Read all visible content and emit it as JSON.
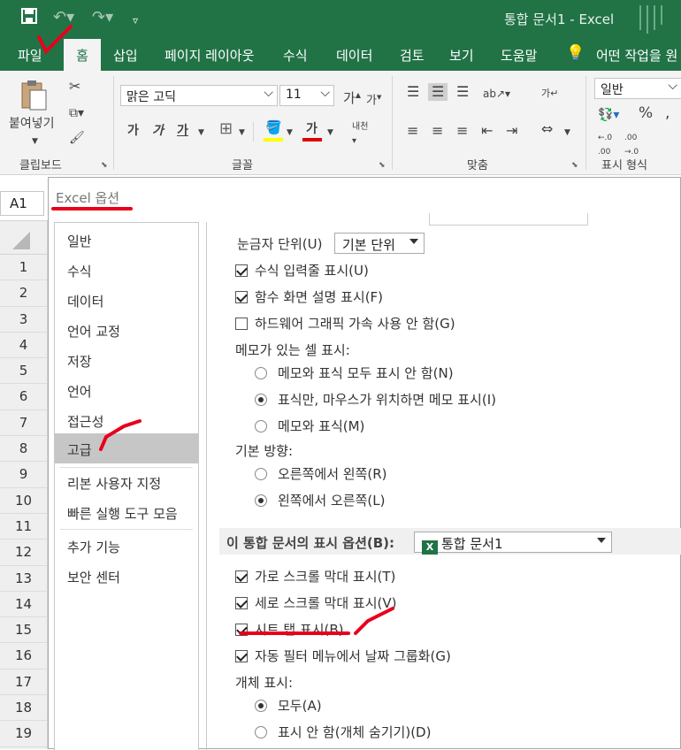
{
  "titlebar": {
    "doc_title": "통합 문서1 - Excel"
  },
  "ribbon_tabs": [
    "파일",
    "홈",
    "삽입",
    "페이지 레이아웃",
    "수식",
    "데이터",
    "검토",
    "보기",
    "도움말",
    "어떤 작업을 원"
  ],
  "ribbon": {
    "paste_label": "붙여넣기",
    "clipboard_label": "클립보드",
    "font_name": "맑은 고딕",
    "font_size": "11",
    "font_label": "글꼴",
    "align_label": "맞춤",
    "number_format": "일반",
    "number_label": "표시 형식",
    "bold": "가",
    "italic": "가",
    "underline": "가",
    "font_color": "가",
    "grow": "가",
    "shrink": "가",
    "percent": "%"
  },
  "formula_bar": {
    "name_box": "A1"
  },
  "row_numbers": [
    "1",
    "2",
    "3",
    "4",
    "5",
    "6",
    "7",
    "8",
    "9",
    "10",
    "11",
    "12",
    "13",
    "14",
    "15",
    "16",
    "17",
    "18",
    "19"
  ],
  "dialog": {
    "title": "Excel 옵션",
    "nav": [
      "일반",
      "수식",
      "데이터",
      "언어 교정",
      "저장",
      "언어",
      "접근성",
      "고급",
      "리본 사용자 지정",
      "빠른 실행 도구 모음",
      "추가 기능",
      "보안 센터"
    ],
    "selected_nav": "고급",
    "ruler_label": "눈금자 단위(U)",
    "ruler_value": "기본 단위",
    "checkboxes_top": [
      {
        "label": "수식 입력줄 표시(U)",
        "checked": true
      },
      {
        "label": "함수 화면 설명 표시(F)",
        "checked": true
      },
      {
        "label": "하드웨어 그래픽 가속 사용 안 함(G)",
        "checked": false
      }
    ],
    "memo_label": "메모가 있는 셀 표시:",
    "memo_options": [
      {
        "label": "메모와 표식 모두 표시 안 함(N)",
        "checked": false
      },
      {
        "label": "표식만, 마우스가 위치하면 메모 표시(I)",
        "checked": true
      },
      {
        "label": "메모와 표식(M)",
        "checked": false
      }
    ],
    "direction_label": "기본 방향:",
    "direction_options": [
      {
        "label": "오른쪽에서 왼쪽(R)",
        "checked": false
      },
      {
        "label": "왼쪽에서 오른쪽(L)",
        "checked": true
      }
    ],
    "workbook_section_label": "이 통합 문서의 표시 옵션(B):",
    "workbook_value": "통합 문서1",
    "checkboxes_wb": [
      {
        "label": "가로 스크롤 막대 표시(T)",
        "checked": true
      },
      {
        "label": "세로 스크롤 막대 표시(V)",
        "checked": true
      },
      {
        "label": "시트 탭 표시(B)",
        "checked": true
      },
      {
        "label": "자동 필터 메뉴에서 날짜 그룹화(G)",
        "checked": true
      }
    ],
    "object_label": "개체 표시:",
    "object_options": [
      {
        "label": "모두(A)",
        "checked": true
      },
      {
        "label": "표시 안 함(개체 숨기기)(D)",
        "checked": false
      }
    ]
  },
  "colors": {
    "excel_green": "#217346",
    "annotation_red": "#e8001c"
  }
}
